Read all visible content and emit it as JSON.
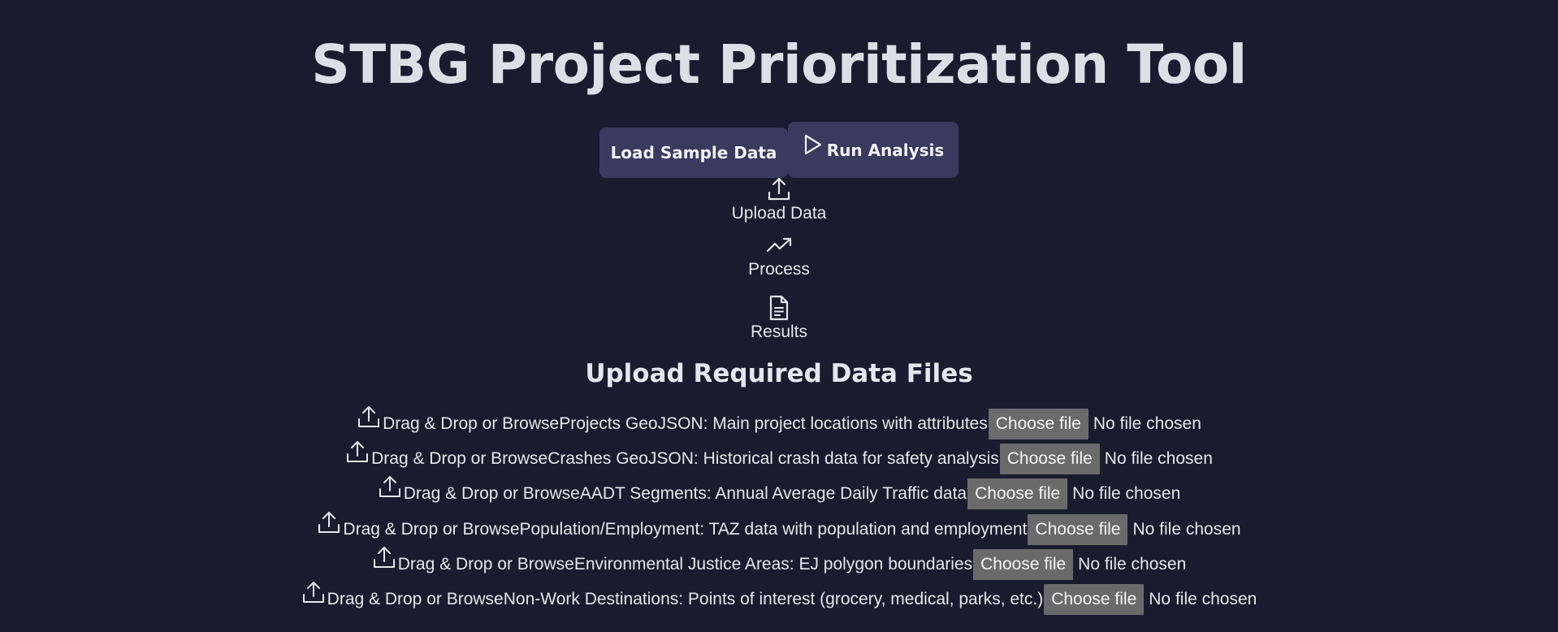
{
  "app": {
    "title": "STBG Project Prioritization Tool"
  },
  "actions": {
    "load_label": "Load Sample Data",
    "run_label": "Run Analysis"
  },
  "steps": [
    {
      "label": "Upload Data",
      "icon": "upload-icon"
    },
    {
      "label": "Process",
      "icon": "trending-up-icon"
    },
    {
      "label": "Results",
      "icon": "document-icon"
    }
  ],
  "upload_section": {
    "title": "Upload Required Data Files",
    "rows": [
      {
        "prompt": "Drag & Drop or Browse",
        "description": "Projects GeoJSON: Main project locations with attributes",
        "button": "Choose file",
        "status": "No file chosen"
      },
      {
        "prompt": "Drag & Drop or Browse",
        "description": "Crashes GeoJSON: Historical crash data for safety analysis",
        "button": "Choose file",
        "status": "No file chosen"
      },
      {
        "prompt": "Drag & Drop or Browse",
        "description": "AADT Segments: Annual Average Daily Traffic data",
        "button": "Choose file",
        "status": "No file chosen"
      },
      {
        "prompt": "Drag & Drop or Browse",
        "description": "Population/Employment: TAZ data with population and employment",
        "button": "Choose file",
        "status": "No file chosen"
      },
      {
        "prompt": "Drag & Drop or Browse",
        "description": "Environmental Justice Areas: EJ polygon boundaries",
        "button": "Choose file",
        "status": "No file chosen"
      },
      {
        "prompt": "Drag & Drop or Browse",
        "description": "Non-Work Destinations: Points of interest (grocery, medical, parks, etc.)",
        "button": "Choose file",
        "status": "No file chosen"
      }
    ]
  },
  "colors": {
    "background": "#1b1b2f",
    "button": "#3a3a5e",
    "file_button": "#6a6a6a",
    "text": "#e6e6ee"
  }
}
